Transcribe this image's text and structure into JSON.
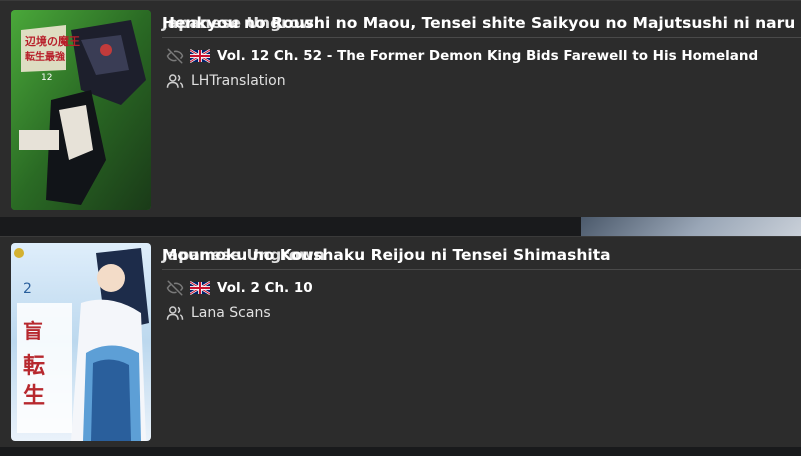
{
  "feed": [
    {
      "title": "Henkyou no Roushi no Maou, Tensei shite Saikyou no Majutsushi ni naru",
      "title_overlap": "Japanese Ungrown",
      "language_icon": "uk-flag-icon",
      "visibility_icon": "eye-off-icon",
      "chapter": "Vol. 12 Ch. 52 - The Former Demon King Bids Farewell to His Homeland",
      "group_icon": "users-icon",
      "group": "LHTranslation",
      "cover_colors": [
        "#3a8a2f",
        "#1c1c2a",
        "#c23b3b"
      ]
    },
    {
      "title": "Moumoku no Koushaku Reijou ni Tensei Shimashita",
      "title_overlap": "Japanese Ungrown",
      "language_icon": "uk-flag-icon",
      "visibility_icon": "eye-off-icon",
      "chapter": "Vol. 2 Ch. 10",
      "group_icon": "users-icon",
      "group": "Lana Scans",
      "cover_colors": [
        "#6fa8d8",
        "#ffffff",
        "#b7282e"
      ]
    }
  ],
  "colors": {
    "page_bg": "#191a1c",
    "card_bg": "#2c2c2c",
    "divider": "#4a4a4a",
    "text": "#ffffff"
  }
}
